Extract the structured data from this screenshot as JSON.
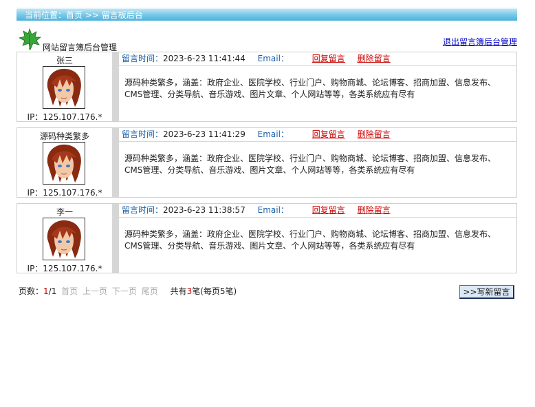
{
  "breadcrumb": "当前位置：首页 >> 留言板后台",
  "header": {
    "title": "网站留言簿后台管理",
    "logout_label": "退出留言簿后台管理"
  },
  "entries": [
    {
      "name": "张三",
      "ip": "IP：125.107.176.*",
      "time_label": "留言时间：",
      "time": "2023-6-23 11:41:44",
      "email_label": "Email：",
      "reply_label": "回复留言",
      "delete_label": "删除留言",
      "content": "源码种类繁多，涵盖：政府企业、医院学校、行业门户、购物商城、论坛博客、招商加盟、信息发布、CMS管理、分类导航、音乐游戏、图片文章、个人网站等等，各类系统应有尽有"
    },
    {
      "name": "源码种类繁多",
      "ip": "IP：125.107.176.*",
      "time_label": "留言时间：",
      "time": "2023-6-23 11:41:29",
      "email_label": "Email：",
      "reply_label": "回复留言",
      "delete_label": "删除留言",
      "content": "源码种类繁多，涵盖：政府企业、医院学校、行业门户、购物商城、论坛博客、招商加盟、信息发布、CMS管理、分类导航、音乐游戏、图片文章、个人网站等等，各类系统应有尽有"
    },
    {
      "name": "李一",
      "ip": "IP：125.107.176.*",
      "time_label": "留言时间：",
      "time": "2023-6-23 11:38:57",
      "email_label": "Email：",
      "reply_label": "回复留言",
      "delete_label": "删除留言",
      "content": "源码种类繁多，涵盖：政府企业、医院学校、行业门户、购物商城、论坛博客、招商加盟、信息发布、CMS管理、分类导航、音乐游戏、图片文章、个人网站等等，各类系统应有尽有"
    }
  ],
  "pager": {
    "label": "页数：",
    "current": "1",
    "total_pages": "/1",
    "first": "首页",
    "prev": "上一页",
    "next": "下一页",
    "last": "尾页",
    "total_prefix": "共有",
    "count": "3",
    "total_suffix": "笔(每页5笔)"
  },
  "write_button": ">>写新留言",
  "colors": {
    "link_blue": "#0000cc",
    "label_blue": "#1a5fa8",
    "action_red": "#cc0000",
    "topbar_blue": "#4cb1dc"
  },
  "icons": {
    "leaf": "maple-leaf-icon",
    "avatar": "user-avatar"
  }
}
